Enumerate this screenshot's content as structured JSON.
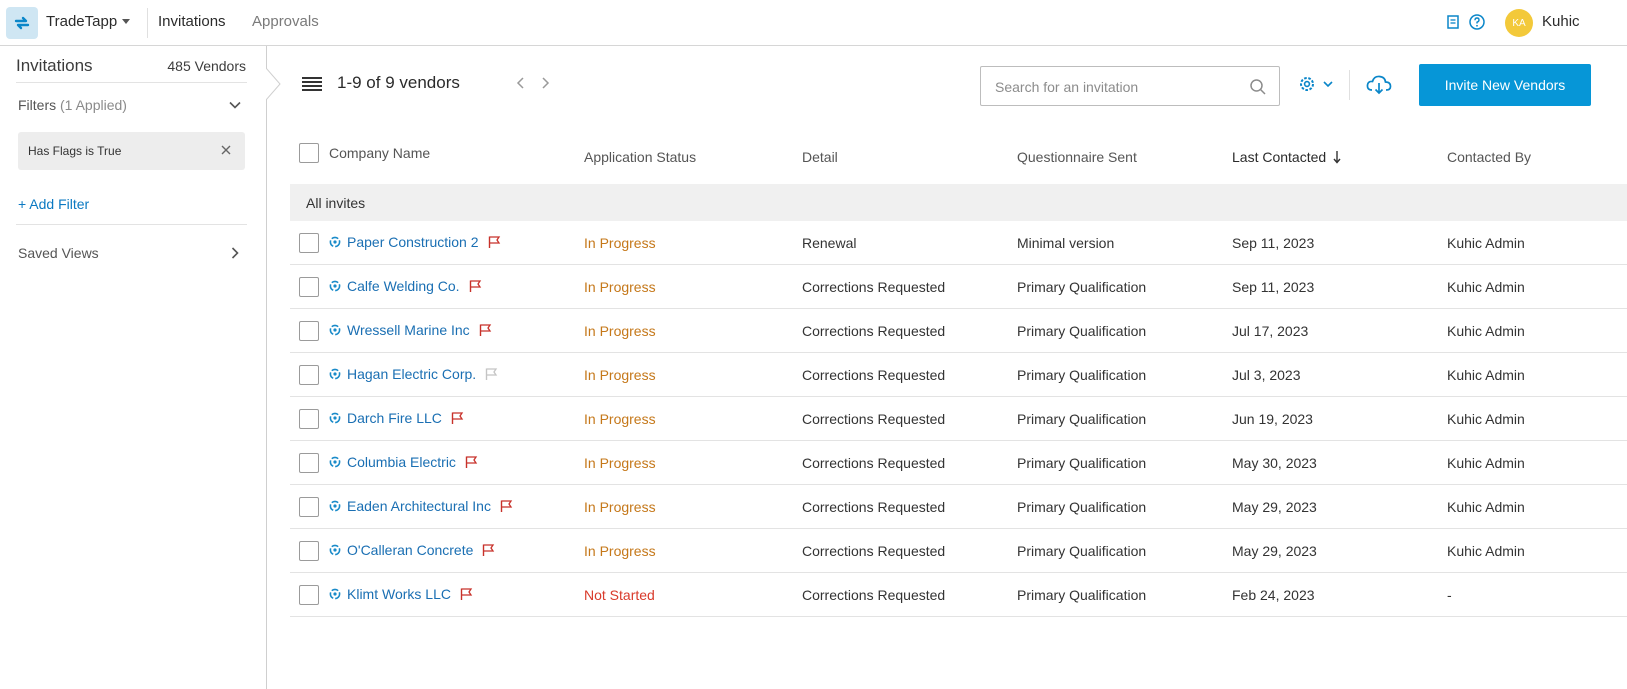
{
  "topbar": {
    "app_name": "TradeTapp",
    "tabs": [
      {
        "label": "Invitations",
        "active": true
      },
      {
        "label": "Approvals",
        "active": false
      }
    ],
    "user": {
      "initials": "KA",
      "name": "Kuhic"
    },
    "icons": [
      "document-icon",
      "help-icon"
    ]
  },
  "sidebar": {
    "title": "Invitations",
    "vendor_count": "485 Vendors",
    "filters_label": "Filters",
    "filters_applied": "(1 Applied)",
    "active_filter": "Has Flags is True",
    "add_filter": "+ Add Filter",
    "saved_views": "Saved Views"
  },
  "main": {
    "count_text": "1-9 of 9 vendors",
    "search_placeholder": "Search for an invitation",
    "invite_button": "Invite New Vendors"
  },
  "table": {
    "columns": [
      "Company Name",
      "Application Status",
      "Detail",
      "Questionnaire Sent",
      "Last Contacted",
      "Contacted By"
    ],
    "sorted_column": "Last Contacted",
    "sort_direction": "desc",
    "group_label": "All invites",
    "rows": [
      {
        "company": "Paper Construction 2",
        "flag": "red",
        "status": "In Progress",
        "detail": "Renewal",
        "questionnaire": "Minimal version",
        "last_contacted": "Sep 11, 2023",
        "contacted_by": "Kuhic Admin"
      },
      {
        "company": "Calfe Welding Co.",
        "flag": "red",
        "status": "In Progress",
        "detail": "Corrections Requested",
        "questionnaire": "Primary Qualification",
        "last_contacted": "Sep 11, 2023",
        "contacted_by": "Kuhic Admin"
      },
      {
        "company": "Wressell Marine Inc",
        "flag": "red",
        "status": "In Progress",
        "detail": "Corrections Requested",
        "questionnaire": "Primary Qualification",
        "last_contacted": "Jul 17, 2023",
        "contacted_by": "Kuhic Admin"
      },
      {
        "company": "Hagan Electric Corp.",
        "flag": "gray",
        "status": "In Progress",
        "detail": "Corrections Requested",
        "questionnaire": "Primary Qualification",
        "last_contacted": "Jul 3, 2023",
        "contacted_by": "Kuhic Admin"
      },
      {
        "company": "Darch Fire LLC",
        "flag": "red",
        "status": "In Progress",
        "detail": "Corrections Requested",
        "questionnaire": "Primary Qualification",
        "last_contacted": "Jun 19, 2023",
        "contacted_by": "Kuhic Admin"
      },
      {
        "company": "Columbia Electric",
        "flag": "red",
        "status": "In Progress",
        "detail": "Corrections Requested",
        "questionnaire": "Primary Qualification",
        "last_contacted": "May 30, 2023",
        "contacted_by": "Kuhic Admin"
      },
      {
        "company": "Eaden Architectural Inc",
        "flag": "red",
        "status": "In Progress",
        "detail": "Corrections Requested",
        "questionnaire": "Primary Qualification",
        "last_contacted": "May 29, 2023",
        "contacted_by": "Kuhic Admin"
      },
      {
        "company": "O'Calleran Concrete",
        "flag": "red",
        "status": "In Progress",
        "detail": "Corrections Requested",
        "questionnaire": "Primary Qualification",
        "last_contacted": "May 29, 2023",
        "contacted_by": "Kuhic Admin"
      },
      {
        "company": "Klimt Works LLC",
        "flag": "red",
        "status": "Not Started",
        "detail": "Corrections Requested",
        "questionnaire": "Primary Qualification",
        "last_contacted": "Feb 24, 2023",
        "contacted_by": "-"
      }
    ]
  },
  "colors": {
    "accent": "#0696d7",
    "link": "#1a6fb3",
    "in_progress": "#c5781a",
    "not_started": "#d93a2b",
    "flag_red": "#c8312a",
    "flag_gray": "#c4c4c4"
  }
}
